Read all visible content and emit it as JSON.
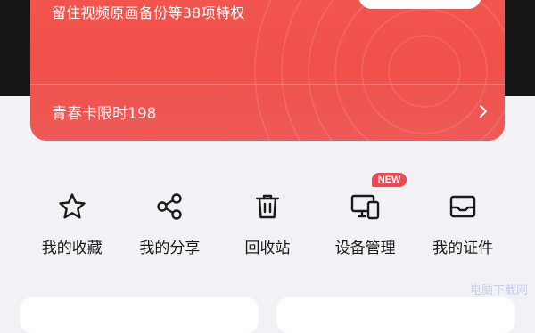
{
  "vip_card": {
    "description": "留住视频原画备份等38项特权",
    "footer_text": "青春卡限时198"
  },
  "shortcuts": [
    {
      "label": "我的收藏",
      "icon": "star-icon"
    },
    {
      "label": "我的分享",
      "icon": "share-icon"
    },
    {
      "label": "回收站",
      "icon": "trash-icon"
    },
    {
      "label": "设备管理",
      "icon": "devices-icon",
      "badge": "NEW"
    },
    {
      "label": "我的证件",
      "icon": "id-card-icon"
    }
  ],
  "watermark": "电脑下载网",
  "colors": {
    "card_red": "#f0504a",
    "badge_red": "#f0464f",
    "page_bg": "#f2f2f6"
  }
}
